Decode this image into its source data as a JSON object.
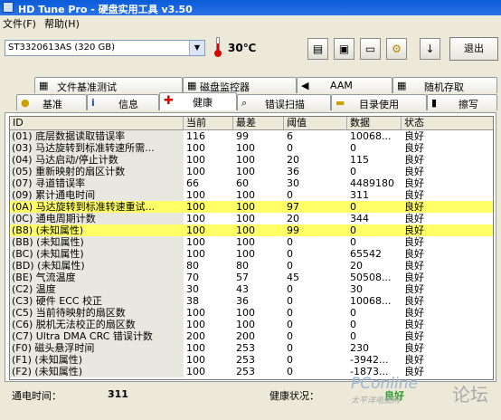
{
  "window": {
    "title": "HD Tune Pro - 硬盘实用工具 v3.50"
  },
  "menu": [
    "文件(F)",
    "帮助(H)"
  ],
  "toolbar": {
    "drive": "ST3320613AS (320 GB)",
    "temperature": "30℃",
    "exit_label": "退出",
    "buttons": [
      "copy-text-icon",
      "copy-screen-icon",
      "save-icon",
      "options-icon",
      "down-arrow-icon"
    ]
  },
  "tabs_top": [
    {
      "label": "文件基准测试",
      "icon": "file-bench-icon"
    },
    {
      "label": "磁盘监控器",
      "icon": "disk-monitor-icon"
    },
    {
      "label": "AAM",
      "icon": "speaker-icon"
    },
    {
      "label": "随机存取",
      "icon": "random-access-icon"
    }
  ],
  "tabs_bottom": [
    {
      "label": "基准",
      "icon": "bulb-icon"
    },
    {
      "label": "信息",
      "icon": "info-icon"
    },
    {
      "label": "健康",
      "icon": "health-cross-icon",
      "active": true
    },
    {
      "label": "错误扫描",
      "icon": "magnifier-icon"
    },
    {
      "label": "目录使用",
      "icon": "folder-icon"
    },
    {
      "label": "擦写",
      "icon": "trash-icon"
    }
  ],
  "table": {
    "columns": [
      "ID",
      "当前",
      "最差",
      "阈值",
      "数据",
      "状态"
    ],
    "rows": [
      {
        "id": "(01) 底层数据读取错误率",
        "cur": "116",
        "worst": "99",
        "thr": "6",
        "data": "10068...",
        "status": "良好"
      },
      {
        "id": "(03) 马达旋转到标准转速所需...",
        "cur": "100",
        "worst": "100",
        "thr": "0",
        "data": "0",
        "status": "良好"
      },
      {
        "id": "(04) 马达启动/停止计数",
        "cur": "100",
        "worst": "100",
        "thr": "20",
        "data": "115",
        "status": "良好"
      },
      {
        "id": "(05) 重新映射的扇区计数",
        "cur": "100",
        "worst": "100",
        "thr": "36",
        "data": "0",
        "status": "良好"
      },
      {
        "id": "(07) 寻道错误率",
        "cur": "66",
        "worst": "60",
        "thr": "30",
        "data": "4489180",
        "status": "良好"
      },
      {
        "id": "(09) 累计通电时间",
        "cur": "100",
        "worst": "100",
        "thr": "0",
        "data": "311",
        "status": "良好"
      },
      {
        "id": "(0A) 马达旋转到标准转速重试...",
        "cur": "100",
        "worst": "100",
        "thr": "97",
        "data": "0",
        "status": "良好",
        "highlight": true
      },
      {
        "id": "(0C) 通电周期计数",
        "cur": "100",
        "worst": "100",
        "thr": "20",
        "data": "344",
        "status": "良好"
      },
      {
        "id": "(B8) (未知属性)",
        "cur": "100",
        "worst": "100",
        "thr": "99",
        "data": "0",
        "status": "良好",
        "highlight": true
      },
      {
        "id": "(BB) (未知属性)",
        "cur": "100",
        "worst": "100",
        "thr": "0",
        "data": "0",
        "status": "良好"
      },
      {
        "id": "(BC) (未知属性)",
        "cur": "100",
        "worst": "100",
        "thr": "0",
        "data": "65542",
        "status": "良好"
      },
      {
        "id": "(BD) (未知属性)",
        "cur": "80",
        "worst": "80",
        "thr": "0",
        "data": "20",
        "status": "良好"
      },
      {
        "id": "(BE) 气流温度",
        "cur": "70",
        "worst": "57",
        "thr": "45",
        "data": "50508...",
        "status": "良好"
      },
      {
        "id": "(C2) 温度",
        "cur": "30",
        "worst": "43",
        "thr": "0",
        "data": "30",
        "status": "良好"
      },
      {
        "id": "(C3) 硬件 ECC 校正",
        "cur": "38",
        "worst": "36",
        "thr": "0",
        "data": "10068...",
        "status": "良好"
      },
      {
        "id": "(C5) 当前待映射的扇区数",
        "cur": "100",
        "worst": "100",
        "thr": "0",
        "data": "0",
        "status": "良好"
      },
      {
        "id": "(C6) 脱机无法校正的扇区数",
        "cur": "100",
        "worst": "100",
        "thr": "0",
        "data": "0",
        "status": "良好"
      },
      {
        "id": "(C7) Ultra DMA CRC 错误计数",
        "cur": "200",
        "worst": "200",
        "thr": "0",
        "data": "0",
        "status": "良好"
      },
      {
        "id": "(F0) 磁头悬浮时间",
        "cur": "100",
        "worst": "253",
        "thr": "0",
        "data": "230",
        "status": "良好"
      },
      {
        "id": "(F1) (未知属性)",
        "cur": "100",
        "worst": "253",
        "thr": "0",
        "data": "-3942...",
        "status": "良好"
      },
      {
        "id": "(F2) (未知属性)",
        "cur": "100",
        "worst": "253",
        "thr": "0",
        "data": "-1873...",
        "status": "良好"
      }
    ]
  },
  "status_bar": {
    "power_on_label": "通电时间：",
    "power_on_value": "311",
    "health_label": "健康状况：",
    "health_value": "良好"
  },
  "watermark": {
    "brand": "PConline",
    "sub": "太平洋电脑网",
    "forum": "论坛"
  },
  "colors": {
    "highlight_row": "#ffff66",
    "title_bar": "#0a5bd8",
    "health_ok": "#2a9a2a"
  }
}
